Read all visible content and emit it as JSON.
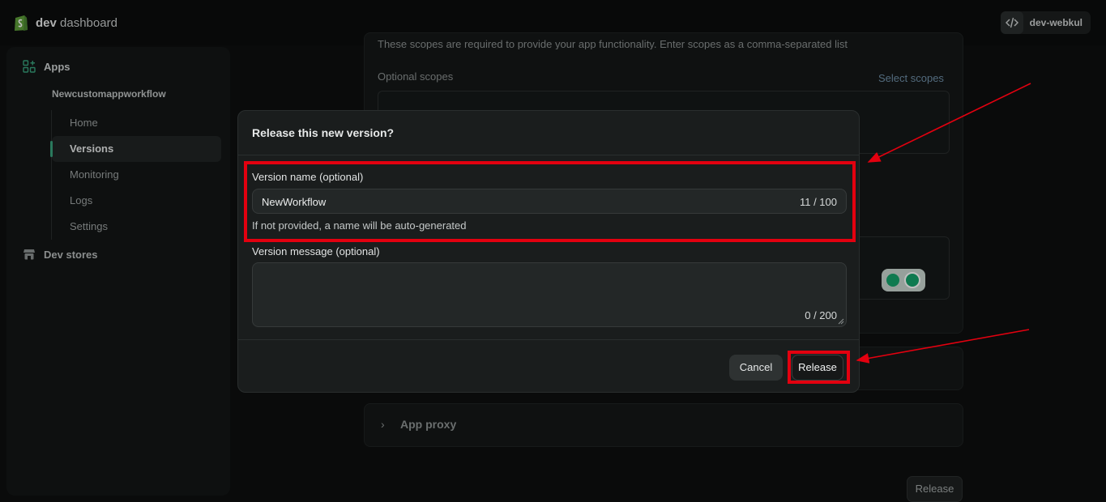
{
  "topbar": {
    "brand_bold": "dev",
    "brand_rest": "dashboard",
    "account_label": "dev-webkul"
  },
  "sidebar": {
    "apps_label": "Apps",
    "app_name": "Newcustomappworkflow",
    "items": [
      {
        "label": "Home",
        "active": false
      },
      {
        "label": "Versions",
        "active": true
      },
      {
        "label": "Monitoring",
        "active": false
      },
      {
        "label": "Logs",
        "active": false
      },
      {
        "label": "Settings",
        "active": false
      }
    ],
    "dev_stores_label": "Dev stores"
  },
  "background": {
    "scopes_help": "These scopes are required to provide your app functionality. Enter scopes as a comma-separated list",
    "optional_scopes_label": "Optional scopes",
    "select_scopes_link": "Select scopes",
    "app_proxy_label": "App proxy",
    "release_button": "Release"
  },
  "modal": {
    "title": "Release this new version?",
    "version_name_label": "Version name (optional)",
    "version_name_value": "NewWorkflow",
    "version_name_count": "11 / 100",
    "version_name_help": "If not provided, a name will be auto-generated",
    "version_message_label": "Version message (optional)",
    "version_message_value": "",
    "version_message_count": "0 / 200",
    "cancel_label": "Cancel",
    "release_label": "Release"
  },
  "colors": {
    "annotation_red": "#e3000f",
    "accent_green": "#38a27d"
  }
}
